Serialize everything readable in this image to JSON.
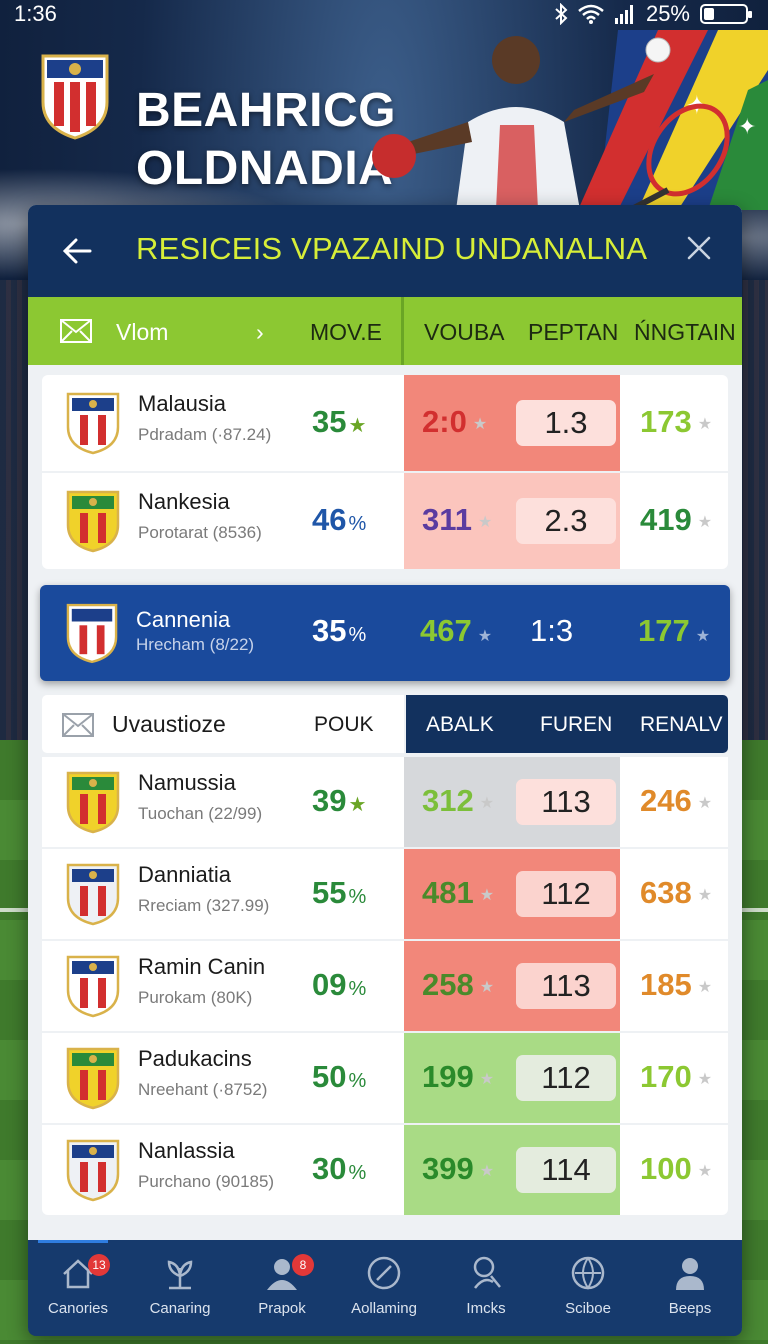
{
  "status_bar": {
    "time": "1:36",
    "battery_text": "25%",
    "battery_level": 0.25
  },
  "hero": {
    "title_line1": "BEAHRICG",
    "title_line2": "OLDNADIA",
    "shield_text": "BEAHRICG"
  },
  "header": {
    "title": "RESICEIS VPAZAIND UNDANALNA"
  },
  "tabs": {
    "first_label": "Vlom",
    "col1": "MOV.E",
    "col2": "VOUBA",
    "col3": "PEPTAN",
    "col4": "ŃNGTAIN"
  },
  "group1": [
    {
      "name": "Malausia",
      "sub": "Pdradam (·87.24)",
      "pct": "35",
      "pct_unit": "★",
      "v1": "2:0",
      "v2": "1.3",
      "v3": "173",
      "cell_color": "#f2877a",
      "v1_color": "#d22f2f",
      "v3_color": "#8cc832",
      "pct_color": "#2a8a3a"
    },
    {
      "name": "Nankesia",
      "sub": "Porotarat (8536)",
      "pct": "46",
      "pct_unit": "%",
      "v1": "311",
      "v2": "2.3",
      "v3": "419",
      "cell_color": "#fbc5bd",
      "v1_color": "#5a3ca0",
      "v3_color": "#2a8a3a",
      "pct_color": "#1f56a8"
    }
  ],
  "highlight_row": {
    "name": "Cannenia",
    "sub": "Hrecham (8/22)",
    "pct": "35",
    "pct_unit": "%",
    "v1": "467",
    "v2": "1:3",
    "v3": "177"
  },
  "section2": {
    "label": "Uvaustioze",
    "col1": "POUK",
    "col2": "ABALK",
    "col3": "FUREN",
    "col4": "RENALV"
  },
  "group2": [
    {
      "name": "Namussia",
      "sub": "Tuochan (22/99)",
      "pct": "39",
      "pct_unit": "★",
      "v1": "312",
      "v2": "113",
      "v3": "246",
      "cell_color": "#d6d8db",
      "v1_color": "#7cbf3a",
      "v3_color": "#e08a2a",
      "pct_color": "#2a8a3a",
      "pill_color": "#fde0dc"
    },
    {
      "name": "Danniatia",
      "sub": "Rreciam (327.99)",
      "pct": "55",
      "pct_unit": "%",
      "v1": "481",
      "v2": "112",
      "v3": "638",
      "cell_color": "#f2877a",
      "v1_color": "#4a8a2a",
      "v3_color": "#e08a2a",
      "pct_color": "#2a8a3a",
      "pill_color": "#fbd3ce"
    },
    {
      "name": "Ramin Canin",
      "sub": "Purokam (80K)",
      "pct": "09",
      "pct_unit": "%",
      "v1": "258",
      "v2": "113",
      "v3": "185",
      "cell_color": "#f2877a",
      "v1_color": "#4a8a2a",
      "v3_color": "#e08a2a",
      "pct_color": "#2a8a3a",
      "pill_color": "#fbd3ce"
    },
    {
      "name": "Padukacins",
      "sub": "Nreehant (·8752)",
      "pct": "50",
      "pct_unit": "%",
      "v1": "199",
      "v2": "112",
      "v3": "170",
      "cell_color": "#a9db85",
      "v1_color": "#2a8a2a",
      "v3_color": "#8cc832",
      "pct_color": "#2a8a3a",
      "pill_color": "#e4ecde"
    },
    {
      "name": "Nanlassia",
      "sub": "Purchano (90185)",
      "pct": "30",
      "pct_unit": "%",
      "v1": "399",
      "v2": "114",
      "v3": "100",
      "cell_color": "#a9db85",
      "v1_color": "#2a8a2a",
      "v3_color": "#8cc832",
      "pct_color": "#2a8a3a",
      "pill_color": "#e4ecde"
    }
  ],
  "nav": [
    {
      "label": "Canories",
      "icon": "home-icon",
      "badge": "13"
    },
    {
      "label": "Canaring",
      "icon": "plant-icon",
      "badge": ""
    },
    {
      "label": "Prapok",
      "icon": "user-icon",
      "badge": "8"
    },
    {
      "label": "Aollaming",
      "icon": "compass-icon",
      "badge": ""
    },
    {
      "label": "Imcks",
      "icon": "search-user-icon",
      "badge": ""
    },
    {
      "label": "Sciboe",
      "icon": "globe-icon",
      "badge": ""
    },
    {
      "label": "Beeps",
      "icon": "person-icon",
      "badge": ""
    }
  ]
}
